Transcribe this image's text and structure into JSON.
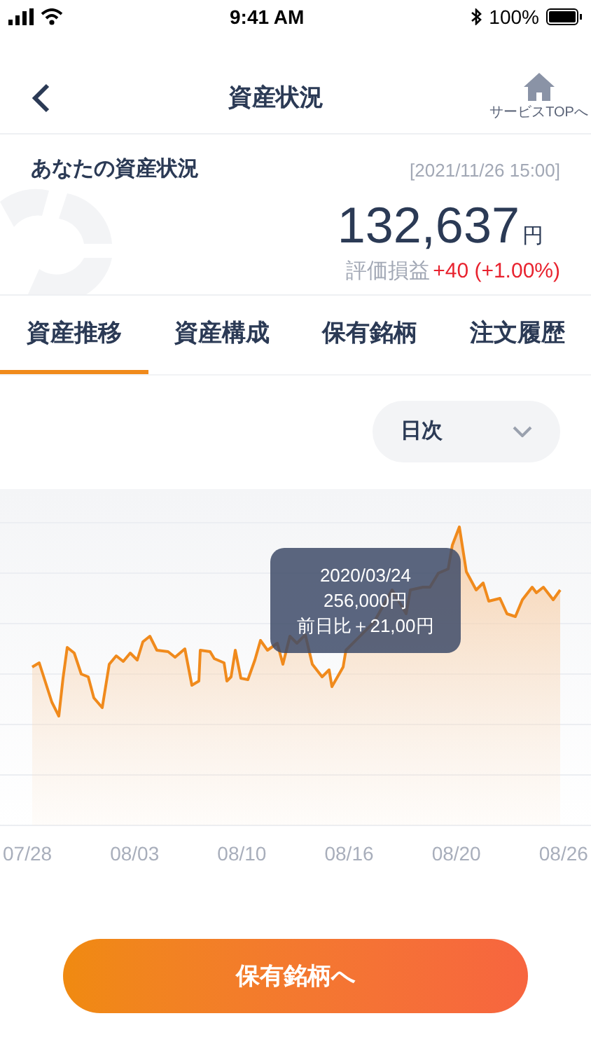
{
  "status_bar": {
    "time": "9:41 AM",
    "battery": "100%"
  },
  "header": {
    "title": "資産状況",
    "home_label": "サービスTOPへ"
  },
  "summary": {
    "title": "あなたの資産状況",
    "timestamp": "[2021/11/26 15:00]",
    "amount": "132,637",
    "unit": "円",
    "pl_label": "評価損益",
    "pl_value": "+40 (+1.00%)"
  },
  "tabs": [
    {
      "label": "資産推移",
      "selected": true
    },
    {
      "label": "資産構成",
      "selected": false
    },
    {
      "label": "保有銘柄",
      "selected": false
    },
    {
      "label": "注文履歴",
      "selected": false
    }
  ],
  "period_select": {
    "value": "日次"
  },
  "chart": {
    "tooltip": [
      "2020/03/24",
      "256,000円",
      "前日比＋21,00円"
    ],
    "x_labels": [
      "07/28",
      "08/03",
      "08/10",
      "08/16",
      "08/20",
      "08/26"
    ]
  },
  "button": {
    "label": "保有銘柄へ"
  }
}
